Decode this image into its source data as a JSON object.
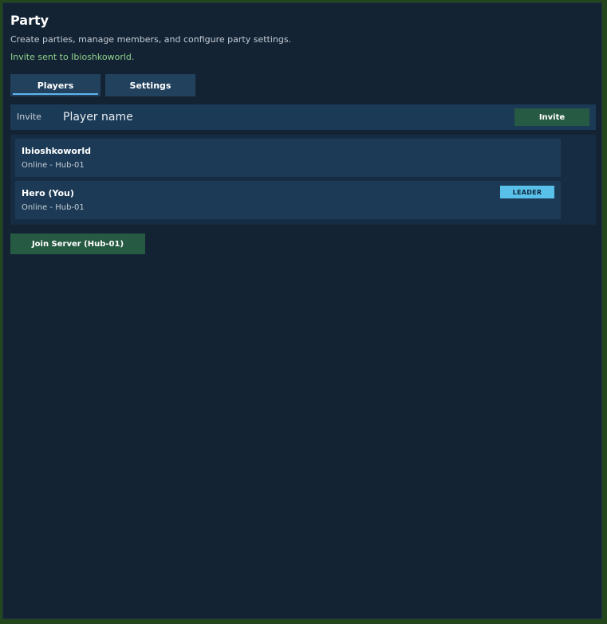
{
  "header": {
    "title": "Party",
    "subtitle": "Create parties, manage members, and configure party settings.",
    "status_message": "Invite sent to Ibioshkoworld."
  },
  "tabs": [
    {
      "label": "Players",
      "active": true
    },
    {
      "label": "Settings",
      "active": false
    }
  ],
  "invite": {
    "label": "Invite",
    "placeholder": "Player name",
    "value": "",
    "button_label": "Invite"
  },
  "members": [
    {
      "name": "Ibioshkoworld",
      "status": "Online - Hub-01",
      "badge": ""
    },
    {
      "name": "Hero (You)",
      "status": "Online - Hub-01",
      "badge": "LEADER"
    }
  ],
  "actions": {
    "join_label": "Join Server (Hub-01)"
  },
  "colors": {
    "background": "#142334",
    "outer_border": "#24461c",
    "panel": "#1b3a55",
    "accent": "#5fb4ee",
    "success_button": "#275a43",
    "status_text": "#8fd18a",
    "leader_badge": "#59c0ea"
  }
}
